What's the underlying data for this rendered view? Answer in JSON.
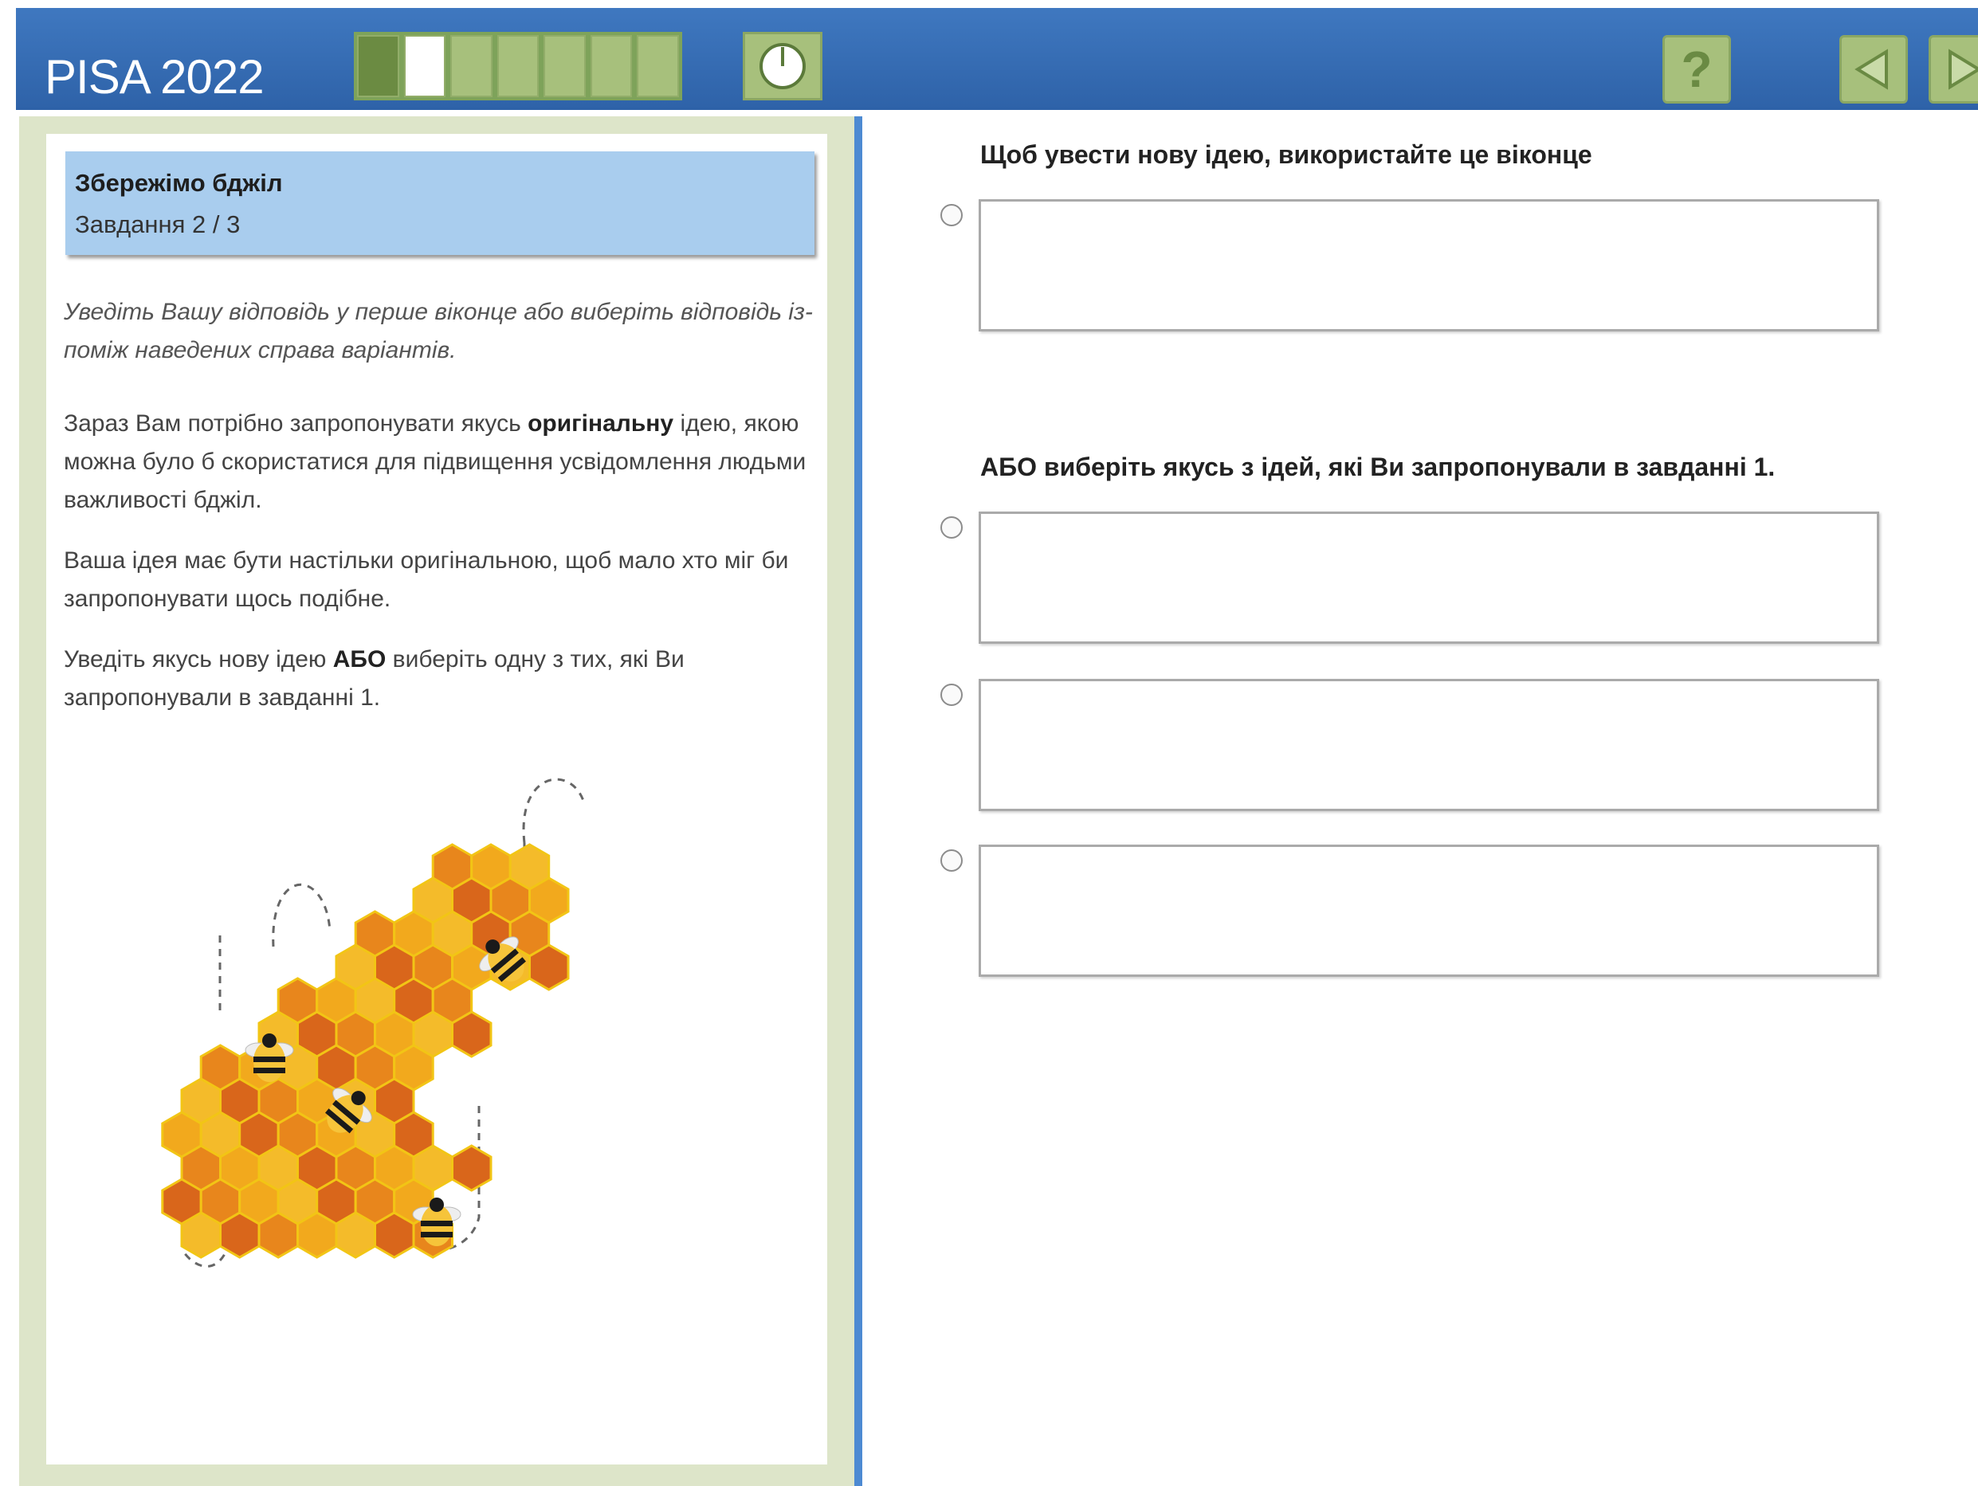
{
  "header": {
    "title": "PISA 2022",
    "progress": {
      "total_tasks": 7,
      "completed": 1,
      "current": 2
    },
    "timer_icon": "clock-icon",
    "help_label": "?",
    "prev_icon": "arrow-left-icon",
    "next_icon": "arrow-right-icon"
  },
  "stimulus": {
    "unit_title": "Збережімо бджіл",
    "task_counter": "Завдання 2 / 3",
    "instruction": "Уведіть Вашу відповідь у перше віконце або виберіть відповідь із-поміж наведених справа варіантів.",
    "paragraph1": {
      "before": "Зараз Вам потрібно запропонувати якусь ",
      "bold": "оригінальну",
      "after": " ідею, якою можна було б скористатися для підвищення усвідомлення людьми важливості бджіл."
    },
    "paragraph2": "Ваша ідея має бути настільки оригінальною, щоб мало хто міг би запропонувати щось подібне.",
    "paragraph3": {
      "before": "Уведіть якусь нову ідею ",
      "bold": "АБО",
      "after": " виберіть одну з тих, які Ви запропонували в завданні 1."
    },
    "illustration": "honeycomb-with-bees"
  },
  "response": {
    "new_idea_heading": "Щоб увести нову ідею, використайте це віконце",
    "new_idea_value": "",
    "previous_heading": "АБО виберіть якусь з ідей, які Ви запропонували в завданні 1.",
    "previous_ideas": [
      "",
      "",
      ""
    ]
  },
  "colors": {
    "header_blue": "#3369b3",
    "nav_green": "#a7c07c",
    "card_blue": "#a9cdee",
    "frame_green": "#dde5c9",
    "honey_orange": "#f0a021"
  }
}
